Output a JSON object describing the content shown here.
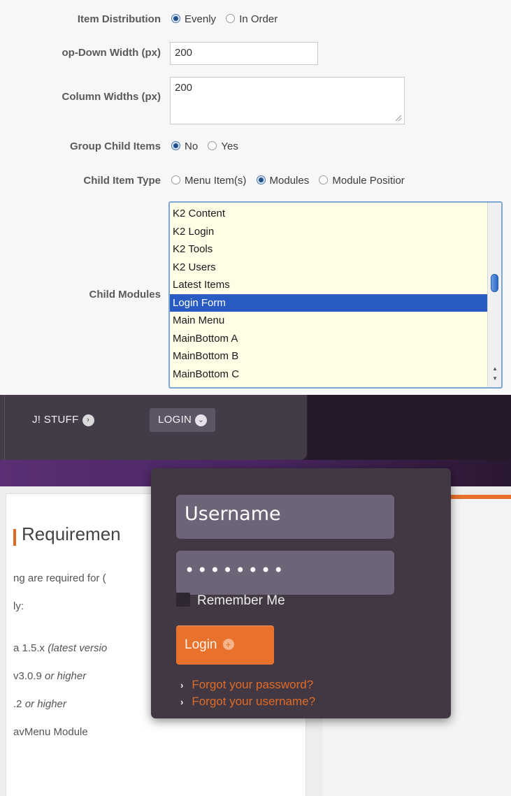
{
  "form": {
    "item_distribution": {
      "label": "Item Distribution",
      "options": [
        "Evenly",
        "In Order"
      ],
      "selected": "Evenly"
    },
    "dropdown_width": {
      "label": "op-Down Width (px)",
      "value": "200"
    },
    "column_widths": {
      "label": "Column Widths (px)",
      "value": "200"
    },
    "group_child_items": {
      "label": "Group Child Items",
      "options": [
        "No",
        "Yes"
      ],
      "selected": "No"
    },
    "child_item_type": {
      "label": "Child Item Type",
      "options": [
        "Menu Item(s)",
        "Modules",
        "Module Positior"
      ],
      "selected": "Modules"
    },
    "child_modules": {
      "label": "Child Modules",
      "items": [
        "K2 Content",
        "K2 Login",
        "K2 Tools",
        "K2 Users",
        "Latest Items",
        "Login Form",
        "Main Menu",
        "MainBottom A",
        "MainBottom B",
        "MainBottom C"
      ],
      "selected": "Login Form"
    }
  },
  "nav": {
    "items": [
      {
        "label": "J! STUFF",
        "icon": "chevron-right-circle-icon"
      },
      {
        "label": "LOGIN",
        "icon": "chevron-down-circle-icon"
      }
    ]
  },
  "content": {
    "title": "Requiremen",
    "lines": [
      {
        "text": "ng are required for (",
        "em": ""
      },
      {
        "text": "ly:",
        "em": ""
      },
      {
        "text": "a 1.5.x ",
        "em": "(latest versio"
      },
      {
        "text": "v3.0.9 ",
        "em": "or higher"
      },
      {
        "text": ".2 ",
        "em": "or higher"
      },
      {
        "text": "avMenu Module",
        "em": ""
      }
    ]
  },
  "login_panel": {
    "username_placeholder": "Username",
    "password_value": "••••••••",
    "remember_label": "Remember Me",
    "login_button": "Login",
    "links": [
      "Forgot your password?",
      "Forgot your username?"
    ]
  },
  "colors": {
    "accent_orange": "#e8712b",
    "panel_bg": "#413844",
    "nav_bg": "#433b48",
    "selection_blue": "#2a5bc2",
    "listbox_bg": "#fefde6"
  }
}
